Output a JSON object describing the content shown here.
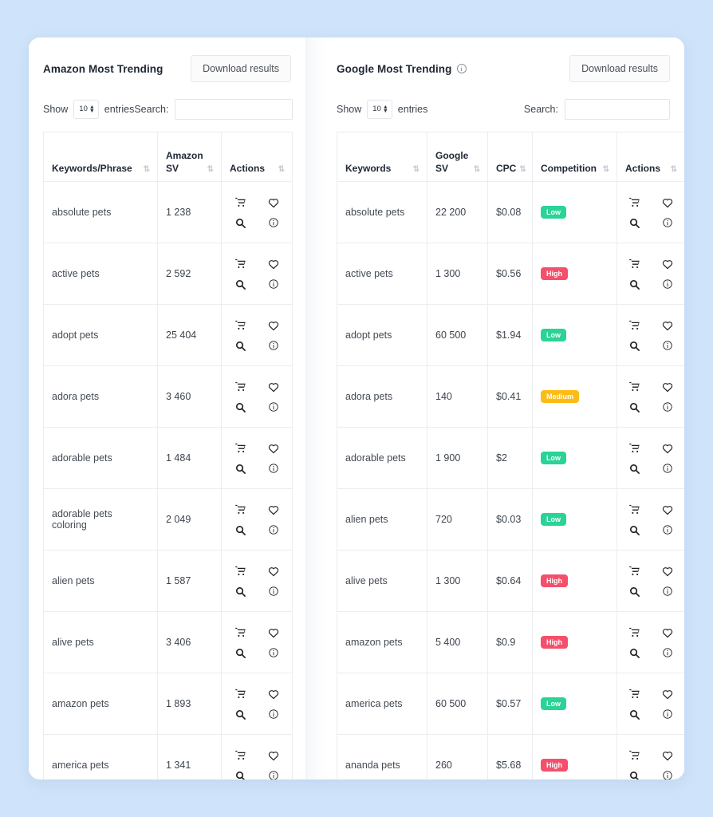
{
  "theme": {
    "page_background": "#cfe4fa",
    "card_background": "#ffffff",
    "badge_low_color": "#2ad396",
    "badge_medium_color": "#fbbc16",
    "badge_high_color": "#f4506b"
  },
  "panels": [
    {
      "id": "amazon",
      "title": "Amazon Most Trending",
      "has_info_icon": false,
      "info_icon_glyph": "i",
      "download_label": "Download results",
      "show_label": "Show",
      "entries_label": "entries",
      "entries_value": "10",
      "search_label": "Search:",
      "search_value": "",
      "search_placeholder": "",
      "columns": [
        "Keywords/Phrase",
        "Amazon SV",
        "Actions"
      ],
      "rows": [
        {
          "keyword": "absolute pets",
          "sv": "1 238"
        },
        {
          "keyword": "active pets",
          "sv": "2 592"
        },
        {
          "keyword": "adopt pets",
          "sv": "25 404"
        },
        {
          "keyword": "adora pets",
          "sv": "3 460"
        },
        {
          "keyword": "adorable pets",
          "sv": "1 484"
        },
        {
          "keyword": "adorable pets coloring",
          "sv": "2 049"
        },
        {
          "keyword": "alien pets",
          "sv": "1 587"
        },
        {
          "keyword": "alive pets",
          "sv": "3 406"
        },
        {
          "keyword": "amazon pets",
          "sv": "1 893"
        },
        {
          "keyword": "america pets",
          "sv": "1 341"
        }
      ]
    },
    {
      "id": "google",
      "title": "Google Most Trending",
      "has_info_icon": true,
      "info_icon_glyph": "i",
      "download_label": "Download results",
      "show_label": "Show",
      "entries_label": "entries",
      "entries_value": "10",
      "search_label": "Search:",
      "search_value": "",
      "search_placeholder": "",
      "columns": [
        "Keywords",
        "Google SV",
        "CPC",
        "Competition",
        "Actions"
      ],
      "rows": [
        {
          "keyword": "absolute pets",
          "sv": "22 200",
          "cpc": "$0.08",
          "competition": "Low"
        },
        {
          "keyword": "active pets",
          "sv": "1 300",
          "cpc": "$0.56",
          "competition": "High"
        },
        {
          "keyword": "adopt pets",
          "sv": "60 500",
          "cpc": "$1.94",
          "competition": "Low"
        },
        {
          "keyword": "adora pets",
          "sv": "140",
          "cpc": "$0.41",
          "competition": "Medium"
        },
        {
          "keyword": "adorable pets",
          "sv": "1 900",
          "cpc": "$2",
          "competition": "Low"
        },
        {
          "keyword": "alien pets",
          "sv": "720",
          "cpc": "$0.03",
          "competition": "Low"
        },
        {
          "keyword": "alive pets",
          "sv": "1 300",
          "cpc": "$0.64",
          "competition": "High"
        },
        {
          "keyword": "amazon pets",
          "sv": "5 400",
          "cpc": "$0.9",
          "competition": "High"
        },
        {
          "keyword": "america pets",
          "sv": "60 500",
          "cpc": "$0.57",
          "competition": "Low"
        },
        {
          "keyword": "ananda pets",
          "sv": "260",
          "cpc": "$5.68",
          "competition": "High"
        }
      ]
    }
  ],
  "icons": {
    "sort": "sort-icon",
    "cart": "cart-icon",
    "heart": "heart-icon",
    "search": "search-icon",
    "info": "info-icon",
    "sort_glyph": "⇅",
    "spinner_up": "▲",
    "spinner_down": "▼"
  }
}
